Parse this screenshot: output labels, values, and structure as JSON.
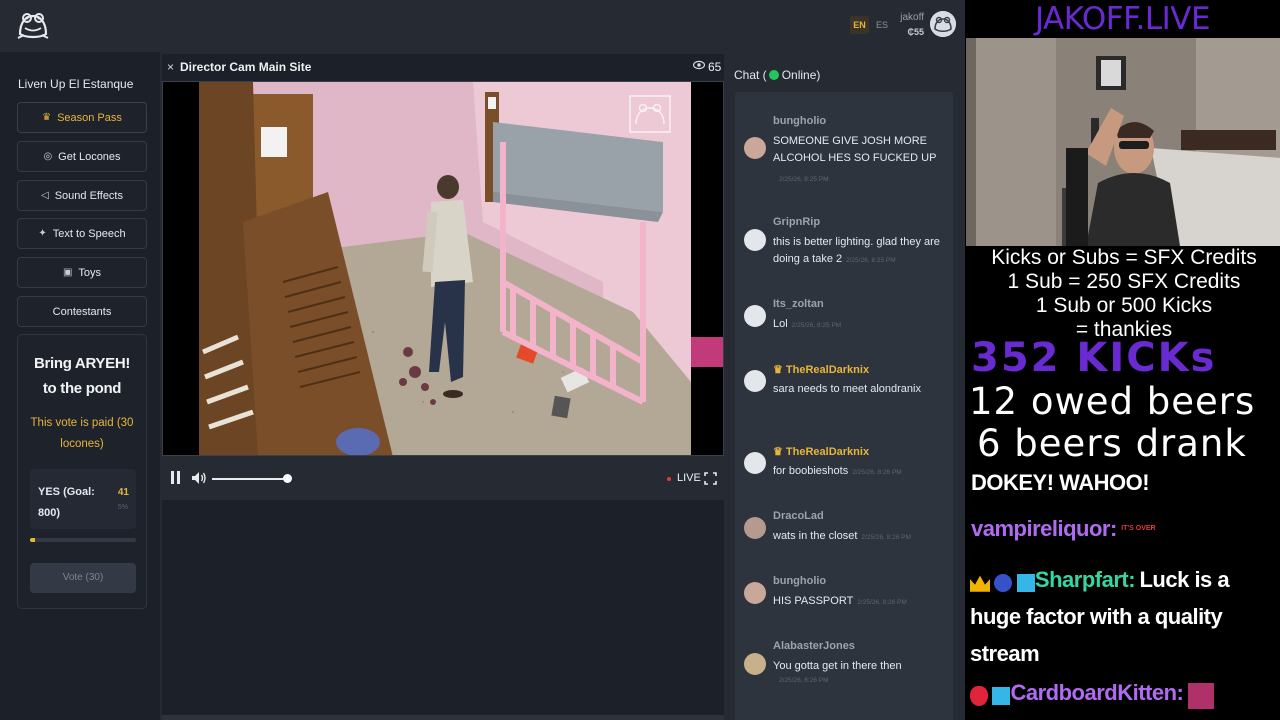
{
  "topbar": {
    "lang_en": "EN",
    "lang_es": "ES",
    "username": "jakoff",
    "credits": "₵55"
  },
  "sidebar": {
    "title": "Liven Up El Estanque",
    "items": [
      {
        "label": "Season Pass",
        "icon": "crown-icon",
        "glyph": "♛",
        "active": true
      },
      {
        "label": "Get Locones",
        "icon": "coin-icon",
        "glyph": "◎"
      },
      {
        "label": "Sound Effects",
        "icon": "speaker-icon",
        "glyph": "◁"
      },
      {
        "label": "Text to Speech",
        "icon": "sparkle-icon",
        "glyph": "✦"
      },
      {
        "label": "Toys",
        "icon": "gift-icon",
        "glyph": "▣"
      },
      {
        "label": "Contestants",
        "icon": "",
        "glyph": ""
      }
    ],
    "vote": {
      "title_line1": "Bring ARYEH!",
      "title_line2": "to the pond",
      "note": "This vote is paid (30 locones)",
      "option_label": "YES (Goal: 800)",
      "option_count": "41",
      "option_pct": "5%",
      "progress_fraction": 0.05,
      "button_label": "Vote (30)"
    }
  },
  "video": {
    "close_glyph": "×",
    "title": "Director Cam Main Site",
    "viewer_count": "65",
    "live_label": "LIVE"
  },
  "chat": {
    "header_prefix": "Chat (",
    "header_suffix": " Online)",
    "messages": [
      {
        "user": "bungholio",
        "vip": false,
        "text": "SOMEONE GIVE JOSH MORE ALCOHOL HES SO FUCKED UP",
        "time": "2/25/26, 8:25 PM",
        "avatar_color": "#c9a89a"
      },
      {
        "user": "GripnRip",
        "vip": false,
        "text": "this is better lighting. glad they are doing a take 2",
        "time": "2/25/26, 8:25 PM",
        "avatar_color": "#e3e6ea"
      },
      {
        "user": "Its_zoltan",
        "vip": false,
        "text": "Lol",
        "time": "2/25/26, 8:25 PM",
        "avatar_color": "#e3e6ea"
      },
      {
        "user": "TheRealDarknix",
        "vip": true,
        "text": "sara needs to meet alondranix",
        "time": "",
        "avatar_color": "#e3e6ea"
      },
      {
        "user": "TheRealDarknix",
        "vip": true,
        "text": "for boobieshots",
        "time": "2/25/26, 8:26 PM",
        "avatar_color": "#e3e6ea"
      },
      {
        "user": "DracoLad",
        "vip": false,
        "text": "wats in the closet",
        "time": "2/25/26, 8:26 PM",
        "avatar_color": "#b79a8e"
      },
      {
        "user": "bungholio",
        "vip": false,
        "text": "HIS PASSPORT",
        "time": "2/25/26, 8:26 PM",
        "avatar_color": "#c9a89a"
      },
      {
        "user": "AlabasterJones",
        "vip": false,
        "text": "You gotta get in there then",
        "time": "2/25/26, 8:26 PM",
        "avatar_color": "#c7b08a"
      }
    ]
  },
  "overlay": {
    "site_title": "JAKOFF.LIVE",
    "rules": [
      "Kicks or Subs = SFX Credits",
      "1 Sub = 250 SFX Credits",
      "1 Sub or 500 Kicks",
      "= thankies"
    ],
    "kick_count": "352 KICKs",
    "owed_beers": "12 owed beers",
    "drank_beers": " 6 beers drank",
    "last_text": "DOKEY! WAHOO!",
    "stream_chat": [
      {
        "user": "vampireliquor:",
        "color": "#b06cf0",
        "text": "",
        "emote_text": "IT'S OVER"
      },
      {
        "user": "Sharpfart:",
        "color": "#35d6a4",
        "text": "Luck is a huge factor with a quality stream"
      },
      {
        "user": "CardboardKitten:",
        "color": "#b06cf0",
        "text": ""
      }
    ]
  },
  "colors": {
    "accent_gold": "#e7b53b",
    "online_green": "#22c55e",
    "live_red": "#e53935",
    "overlay_purple": "#6a2ad1"
  }
}
